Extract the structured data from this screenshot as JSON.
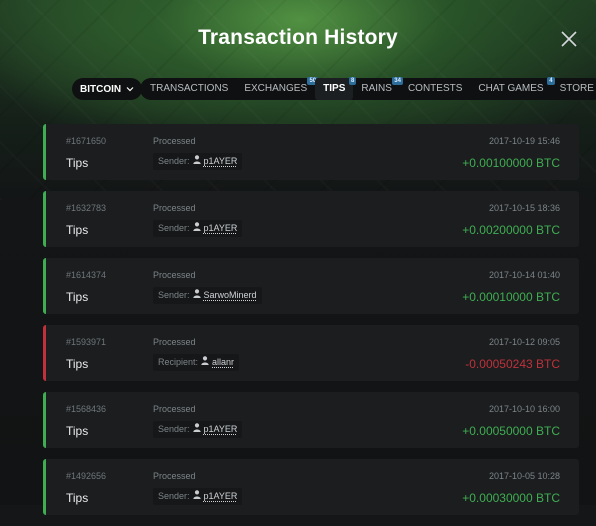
{
  "dialog": {
    "title": "Transaction History",
    "close_icon": "close-icon"
  },
  "currency": {
    "label": "BITCOIN",
    "icon": "chevron-down-icon"
  },
  "tabs": [
    {
      "label": "TRANSACTIONS",
      "badge": "",
      "active": false
    },
    {
      "label": "EXCHANGES",
      "badge": "50",
      "active": false
    },
    {
      "label": "TIPS",
      "badge": "8",
      "active": true
    },
    {
      "label": "RAINS",
      "badge": "34",
      "active": false
    },
    {
      "label": "CONTESTS",
      "badge": "",
      "active": false
    },
    {
      "label": "CHAT GAMES",
      "badge": "4",
      "active": false
    },
    {
      "label": "STORE",
      "badge": "",
      "active": false
    }
  ],
  "colors": {
    "positive": "#3fae52",
    "negative": "#c0313b"
  },
  "transactions": [
    {
      "id": "#1671650",
      "type": "Tips",
      "status": "Processed",
      "party_label": "Sender:",
      "party_name": "p1AYER",
      "date": "2017-10-19 15:46",
      "amount": "+0.00100000 BTC",
      "direction": "positive"
    },
    {
      "id": "#1632783",
      "type": "Tips",
      "status": "Processed",
      "party_label": "Sender:",
      "party_name": "p1AYER",
      "date": "2017-10-15 18:36",
      "amount": "+0.00200000 BTC",
      "direction": "positive"
    },
    {
      "id": "#1614374",
      "type": "Tips",
      "status": "Processed",
      "party_label": "Sender:",
      "party_name": "SarwoMinerd",
      "date": "2017-10-14 01:40",
      "amount": "+0.00010000 BTC",
      "direction": "positive"
    },
    {
      "id": "#1593971",
      "type": "Tips",
      "status": "Processed",
      "party_label": "Recipient:",
      "party_name": "allanr",
      "date": "2017-10-12 09:05",
      "amount": "-0.00050243 BTC",
      "direction": "negative"
    },
    {
      "id": "#1568436",
      "type": "Tips",
      "status": "Processed",
      "party_label": "Sender:",
      "party_name": "p1AYER",
      "date": "2017-10-10 16:00",
      "amount": "+0.00050000 BTC",
      "direction": "positive"
    },
    {
      "id": "#1492656",
      "type": "Tips",
      "status": "Processed",
      "party_label": "Sender:",
      "party_name": "p1AYER",
      "date": "2017-10-05 10:28",
      "amount": "+0.00030000 BTC",
      "direction": "positive"
    }
  ]
}
